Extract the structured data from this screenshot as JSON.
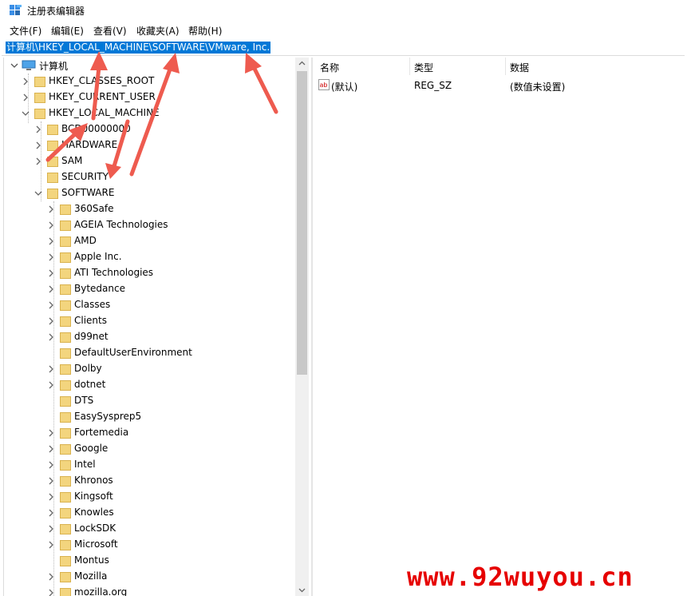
{
  "window": {
    "title": "注册表编辑器"
  },
  "menu": [
    "文件(F)",
    "编辑(E)",
    "查看(V)",
    "收藏夹(A)",
    "帮助(H)"
  ],
  "address": "计算机\\HKEY_LOCAL_MACHINE\\SOFTWARE\\VMware, Inc.",
  "tree": {
    "root": "计算机",
    "hives": [
      "HKEY_CLASSES_ROOT",
      "HKEY_CURRENT_USER",
      "HKEY_LOCAL_MACHINE"
    ],
    "hklm_children": [
      "BCD00000000",
      "HARDWARE",
      "SAM",
      "SECURITY",
      "SOFTWARE"
    ],
    "software_children": [
      "360Safe",
      "AGEIA Technologies",
      "AMD",
      "Apple Inc.",
      "ATI Technologies",
      "Bytedance",
      "Classes",
      "Clients",
      "d99net",
      "DefaultUserEnvironment",
      "Dolby",
      "dotnet",
      "DTS",
      "EasySysprep5",
      "Fortemedia",
      "Google",
      "Intel",
      "Khronos",
      "Kingsoft",
      "Knowles",
      "LockSDK",
      "Microsoft",
      "Montus",
      "Mozilla",
      "mozilla.org"
    ]
  },
  "list": {
    "headers": {
      "name": "名称",
      "type": "类型",
      "data": "数据"
    },
    "rows": [
      {
        "name": "(默认)",
        "type": "REG_SZ",
        "data": "(数值未设置)"
      }
    ]
  },
  "watermark": "www.92wuyou.cn",
  "icons": {
    "app": "regedit-icon",
    "computer": "computer-icon",
    "folder": "folder-icon",
    "value": "string-value-icon"
  },
  "colors": {
    "selection": "#0078d7",
    "folder": "#f3d57e",
    "arrow": "#ee5b4f",
    "watermark": "#e60000"
  }
}
